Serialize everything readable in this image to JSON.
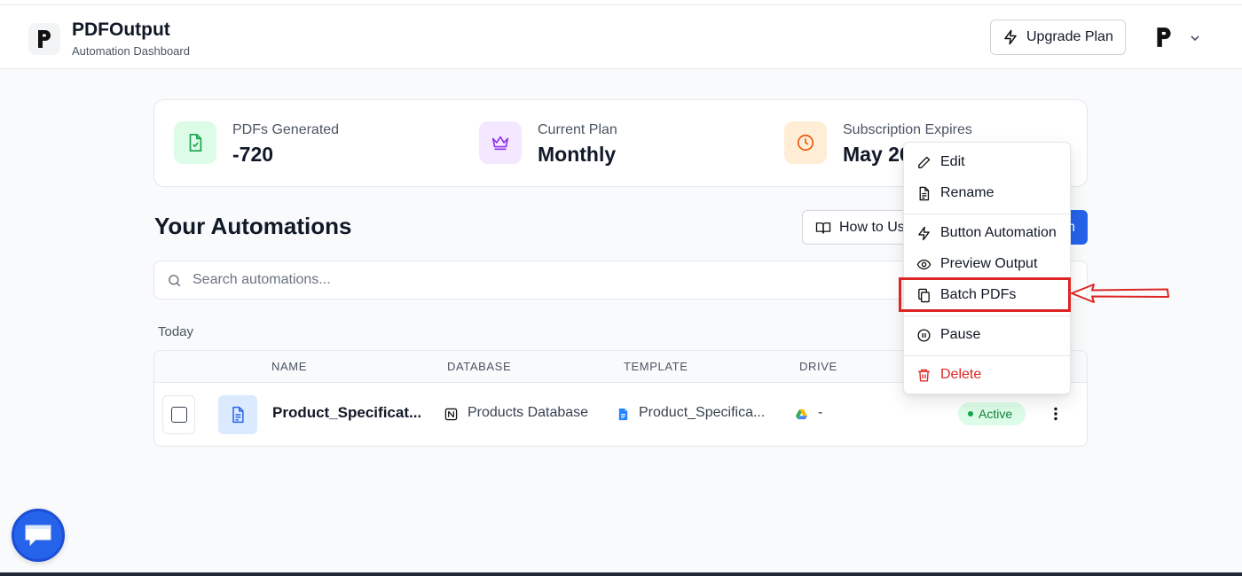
{
  "header": {
    "brand_title": "PDFOutput",
    "brand_subtitle": "Automation Dashboard",
    "upgrade_label": "Upgrade Plan",
    "avatar_letter": "P"
  },
  "stats": [
    {
      "label": "PDFs Generated",
      "value": "-720",
      "icon": "file-check-icon",
      "color": "#16a34a"
    },
    {
      "label": "Current Plan",
      "value": "Monthly",
      "icon": "crown-icon",
      "color": "#9333ea"
    },
    {
      "label": "Subscription Expires",
      "value": "May 20",
      "icon": "clock-icon",
      "color": "#ea580c"
    }
  ],
  "section": {
    "title": "Your Automations",
    "how_to_label": "How to Us",
    "create_label": "n"
  },
  "search": {
    "placeholder": "Search automations..."
  },
  "group_label": "Today",
  "table": {
    "columns": [
      "NAME",
      "DATABASE",
      "TEMPLATE",
      "DRIVE"
    ],
    "rows": [
      {
        "name": "Product_Specificat...",
        "database": "Products Database",
        "template": "Product_Specifica...",
        "drive": "-",
        "status": "Active"
      }
    ]
  },
  "menu": {
    "items": [
      {
        "label": "Edit",
        "icon": "pencil-icon"
      },
      {
        "label": "Rename",
        "icon": "file-text-icon"
      },
      {
        "label": "Button Automation",
        "icon": "bolt-icon"
      },
      {
        "label": "Preview Output",
        "icon": "eye-icon"
      },
      {
        "label": "Batch PDFs",
        "icon": "copy-icon"
      },
      {
        "label": "Pause",
        "icon": "pause-circle-icon"
      },
      {
        "label": "Delete",
        "icon": "trash-icon"
      }
    ],
    "highlighted": "Batch PDFs",
    "annotation_color": "#dc2626"
  },
  "colors": {
    "accent": "#2563eb",
    "danger": "#dc2626",
    "success": "#16a34a"
  }
}
